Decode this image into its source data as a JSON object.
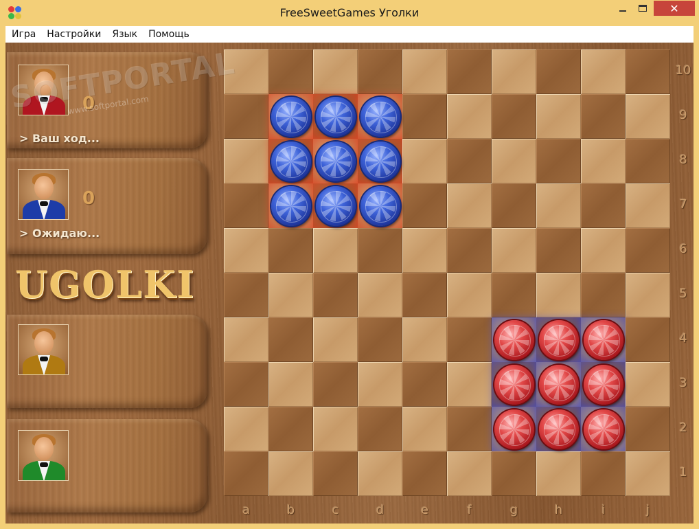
{
  "window": {
    "title": "FreeSweetGames Уголки",
    "close_glyph": "✕"
  },
  "menu": {
    "items": [
      "Игра",
      "Настройки",
      "Язык",
      "Помощь"
    ]
  },
  "players": [
    {
      "score": "0",
      "status": "> Ваш ход...",
      "avatar_color": "#b01620"
    },
    {
      "score": "0",
      "status": "> Ожидаю...",
      "avatar_color": "#1d3ca8"
    },
    {
      "score": "",
      "status": "",
      "avatar_color": "#b07a12"
    },
    {
      "score": "",
      "status": "",
      "avatar_color": "#1f8a2a"
    }
  ],
  "logo": "UGOLKI",
  "board": {
    "files": [
      "a",
      "b",
      "c",
      "d",
      "e",
      "f",
      "g",
      "h",
      "i",
      "j"
    ],
    "ranks": [
      "10",
      "9",
      "8",
      "7",
      "6",
      "5",
      "4",
      "3",
      "2",
      "1"
    ],
    "blue_pieces": [
      "b9",
      "c9",
      "d9",
      "b8",
      "c8",
      "d8",
      "b7",
      "c7",
      "d7"
    ],
    "red_pieces": [
      "g4",
      "h4",
      "i4",
      "g3",
      "h3",
      "i3",
      "g2",
      "h2",
      "i2"
    ],
    "red_zone": [
      "b9",
      "c9",
      "d9",
      "b8",
      "c8",
      "d8",
      "b7",
      "c7",
      "d7"
    ],
    "blue_zone": [
      "g4",
      "h4",
      "i4",
      "g3",
      "h3",
      "i3",
      "g2",
      "h2",
      "i2"
    ]
  },
  "watermark": {
    "brand": "SOFTPORTAL",
    "url": "www.softportal.com"
  }
}
